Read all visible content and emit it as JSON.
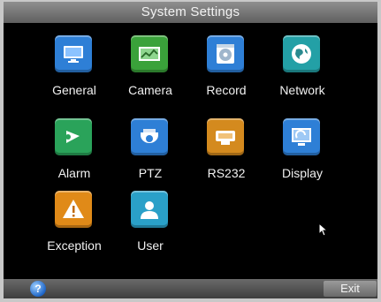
{
  "window": {
    "title": "System Settings"
  },
  "tiles": [
    {
      "label": "General",
      "icon": "monitor-icon",
      "color": "#2e7fd6"
    },
    {
      "label": "Camera",
      "icon": "picture-icon",
      "color": "#3aa23a"
    },
    {
      "label": "Record",
      "icon": "film-reel-icon",
      "color": "#2e7fd6"
    },
    {
      "label": "Network",
      "icon": "globe-icon",
      "color": "#23a0a6"
    },
    {
      "label": "Alarm",
      "icon": "bell-icon",
      "color": "#2aa35a"
    },
    {
      "label": "PTZ",
      "icon": "dome-camera-icon",
      "color": "#2e7fd6"
    },
    {
      "label": "RS232",
      "icon": "serial-port-icon",
      "color": "#d48a1e"
    },
    {
      "label": "Display",
      "icon": "screen-icon",
      "color": "#2e7fd6"
    },
    {
      "label": "Exception",
      "icon": "warning-icon",
      "color": "#e08a18"
    },
    {
      "label": "User",
      "icon": "user-icon",
      "color": "#2aa0c8"
    }
  ],
  "bottom": {
    "help_label": "?",
    "exit_label": "Exit"
  }
}
